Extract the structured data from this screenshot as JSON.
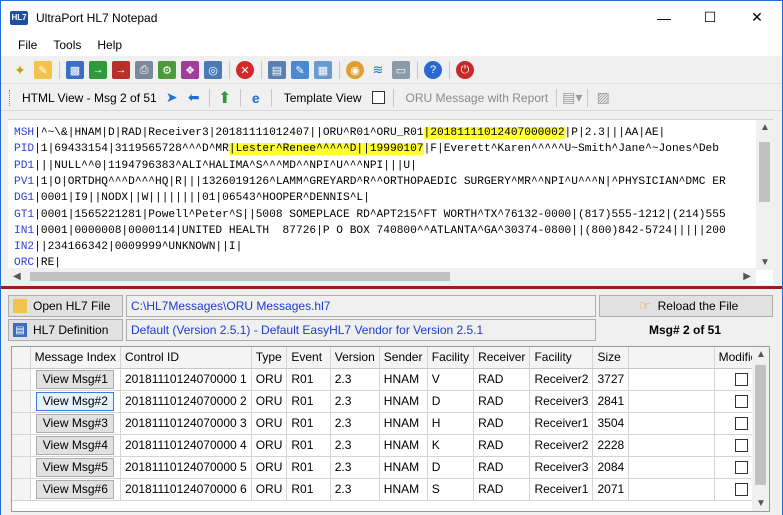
{
  "window": {
    "title": "UltraPort HL7 Notepad",
    "icon_text": "HL7"
  },
  "menu": [
    "File",
    "Tools",
    "Help"
  ],
  "viewbar": {
    "html_view": "HTML View - Msg 2 of 51",
    "template_view": "Template View",
    "oru_report": "ORU Message with Report"
  },
  "editor": {
    "lines": [
      {
        "seg": "MSH",
        "pre": "|^~\\&|HNAM|D|RAD|Receiver3|20181111012407||ORU^R01^ORU_R01",
        "hl": "|20181111012407000002",
        "post": "|P|2.3|||AA|AE|"
      },
      {
        "seg": "PID",
        "pre": "|1|69433154|3119565728^^^D^MR",
        "hl": "|Lester^Renee^^^^^D||19990107",
        "post": "|F|Everett^Karen^^^^^U~Smith^Jane^~Jones^Deb"
      },
      {
        "seg": "PD1",
        "pre": "|||NULL^^0|1194796383^ALI^HALIMA^S^^^MD^^NPI^U^^^NPI|||U|",
        "hl": "",
        "post": ""
      },
      {
        "seg": "PV1",
        "pre": "|1|O|ORTDHQ^^^D^^^HQ|R|||1326019126^LAMM^GREYARD^R^^ORTHOPAEDIC SURGERY^MR^^NPI^U^^^N|^PHYSICIAN^DMC ER",
        "hl": "",
        "post": ""
      },
      {
        "seg": "DG1",
        "pre": "|0001|I9||NODX||W||||||||01|06543^HOOPER^DENNIS^L|",
        "hl": "",
        "post": ""
      },
      {
        "seg": "GT1",
        "pre": "|0001|1565221281|Powell^Peter^S||5008 SOMEPLACE RD^APT215^FT WORTH^TX^76132-0000|(817)555-1212|(214)555",
        "hl": "",
        "post": ""
      },
      {
        "seg": "IN1",
        "pre": "|0001|0000008|0000114|UNITED HEALTH  87726|P O BOX 740800^^ATLANTA^GA^30374-0800||(800)842-5724|||||200",
        "hl": "",
        "post": ""
      },
      {
        "seg": "IN2",
        "pre": "||234166342|0009999^UNKNOWN||I|",
        "hl": "",
        "post": ""
      },
      {
        "seg": "ORC",
        "pre": "|RE|",
        "hl": "",
        "post": ""
      }
    ]
  },
  "panel": {
    "open_button": "Open HL7 File",
    "file_path": "C:\\HL7Messages\\ORU Messages.hl7",
    "reload_button": "Reload the File",
    "definition_button": "HL7 Definition",
    "definition_value": "Default (Version 2.5.1) - Default EasyHL7 Vendor for Version 2.5.1",
    "msg_count": "Msg# 2 of 51"
  },
  "grid": {
    "columns": [
      "Message Index",
      "Control ID",
      "Type",
      "Event",
      "Version",
      "Sender",
      "Facility",
      "Receiver",
      "Facility",
      "Size",
      "",
      "Modified"
    ],
    "rows": [
      {
        "btn": "View Msg#1",
        "control_id": "20181110124070000 1",
        "type": "ORU",
        "event": "R01",
        "version": "2.3",
        "sender": "HNAM",
        "facility": "V",
        "receiver": "RAD",
        "rfacility": "Receiver2",
        "size": "3727"
      },
      {
        "btn": "View Msg#2",
        "control_id": "20181110124070000 2",
        "type": "ORU",
        "event": "R01",
        "version": "2.3",
        "sender": "HNAM",
        "facility": "D",
        "receiver": "RAD",
        "rfacility": "Receiver3",
        "size": "2841"
      },
      {
        "btn": "View Msg#3",
        "control_id": "20181110124070000 3",
        "type": "ORU",
        "event": "R01",
        "version": "2.3",
        "sender": "HNAM",
        "facility": "H",
        "receiver": "RAD",
        "rfacility": "Receiver1",
        "size": "3504"
      },
      {
        "btn": "View Msg#4",
        "control_id": "20181110124070000 4",
        "type": "ORU",
        "event": "R01",
        "version": "2.3",
        "sender": "HNAM",
        "facility": "K",
        "receiver": "RAD",
        "rfacility": "Receiver2",
        "size": "2228"
      },
      {
        "btn": "View Msg#5",
        "control_id": "20181110124070000 5",
        "type": "ORU",
        "event": "R01",
        "version": "2.3",
        "sender": "HNAM",
        "facility": "D",
        "receiver": "RAD",
        "rfacility": "Receiver3",
        "size": "2084"
      },
      {
        "btn": "View Msg#6",
        "control_id": "20181110124070000 6",
        "type": "ORU",
        "event": "R01",
        "version": "2.3",
        "sender": "HNAM",
        "facility": "S",
        "receiver": "RAD",
        "rfacility": "Receiver1",
        "size": "2071"
      }
    ]
  }
}
